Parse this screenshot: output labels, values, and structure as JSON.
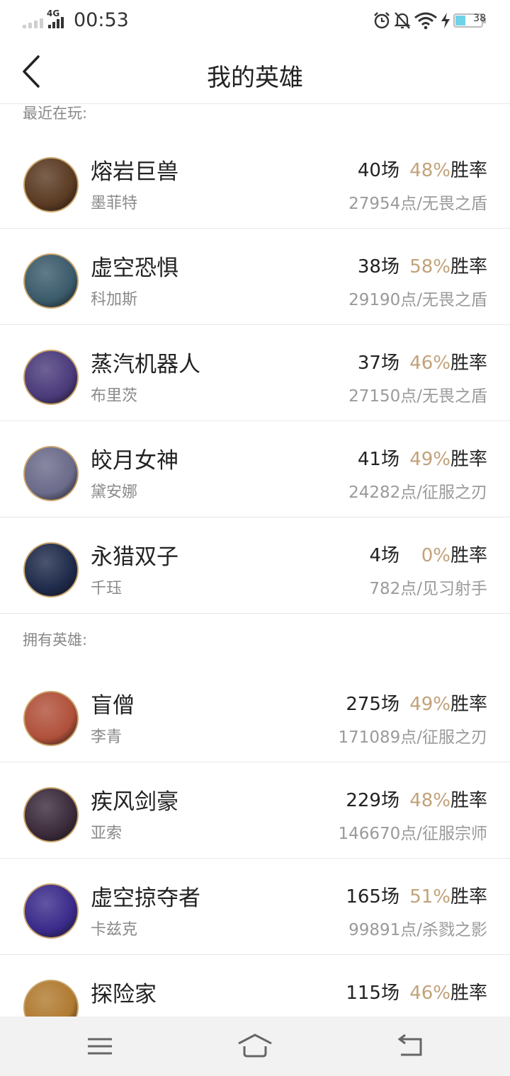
{
  "status_bar": {
    "network": "4G",
    "time": "00:53",
    "battery": "38"
  },
  "header": {
    "title": "我的英雄"
  },
  "sections": [
    {
      "label": "最近在玩:",
      "heroes": [
        {
          "name": "熔岩巨兽",
          "champion": "墨菲特",
          "games": "40场",
          "winrate": "48%",
          "winrate_label": "胜率",
          "points": "27954点/无畏之盾",
          "avatar_color": "#5a3a22"
        },
        {
          "name": "虚空恐惧",
          "champion": "科加斯",
          "games": "38场",
          "winrate": "58%",
          "winrate_label": "胜率",
          "points": "29190点/无畏之盾",
          "avatar_color": "#3a5a6a"
        },
        {
          "name": "蒸汽机器人",
          "champion": "布里茨",
          "games": "37场",
          "winrate": "46%",
          "winrate_label": "胜率",
          "points": "27150点/无畏之盾",
          "avatar_color": "#4a3a7a"
        },
        {
          "name": "皎月女神",
          "champion": "黛安娜",
          "games": "41场",
          "winrate": "49%",
          "winrate_label": "胜率",
          "points": "24282点/征服之刃",
          "avatar_color": "#6a6a8a"
        },
        {
          "name": "永猎双子",
          "champion": "千珏",
          "games": "4场",
          "winrate": "0%",
          "winrate_label": "胜率",
          "points": "782点/见习射手",
          "avatar_color": "#1e2a4a"
        }
      ]
    },
    {
      "label": "拥有英雄:",
      "heroes": [
        {
          "name": "盲僧",
          "champion": "李青",
          "games": "275场",
          "winrate": "49%",
          "winrate_label": "胜率",
          "points": "171089点/征服之刃",
          "avatar_color": "#b0503a"
        },
        {
          "name": "疾风剑豪",
          "champion": "亚索",
          "games": "229场",
          "winrate": "48%",
          "winrate_label": "胜率",
          "points": "146670点/征服宗师",
          "avatar_color": "#3a2a3a"
        },
        {
          "name": "虚空掠夺者",
          "champion": "卡兹克",
          "games": "165场",
          "winrate": "51%",
          "winrate_label": "胜率",
          "points": "99891点/杀戮之影",
          "avatar_color": "#3a2a8a"
        },
        {
          "name": "探险家",
          "champion": "",
          "games": "115场",
          "winrate": "46%",
          "winrate_label": "胜率",
          "points": "",
          "avatar_color": "#b07a30"
        }
      ]
    }
  ],
  "colors": {
    "accent_gold": "#c2a27a",
    "avatar_border": "#c9a46a",
    "divider": "#e8e8e8"
  },
  "nav_bar": {
    "menu_icon": "menu-icon",
    "home_icon": "home-icon",
    "back_icon": "back-return-icon"
  }
}
